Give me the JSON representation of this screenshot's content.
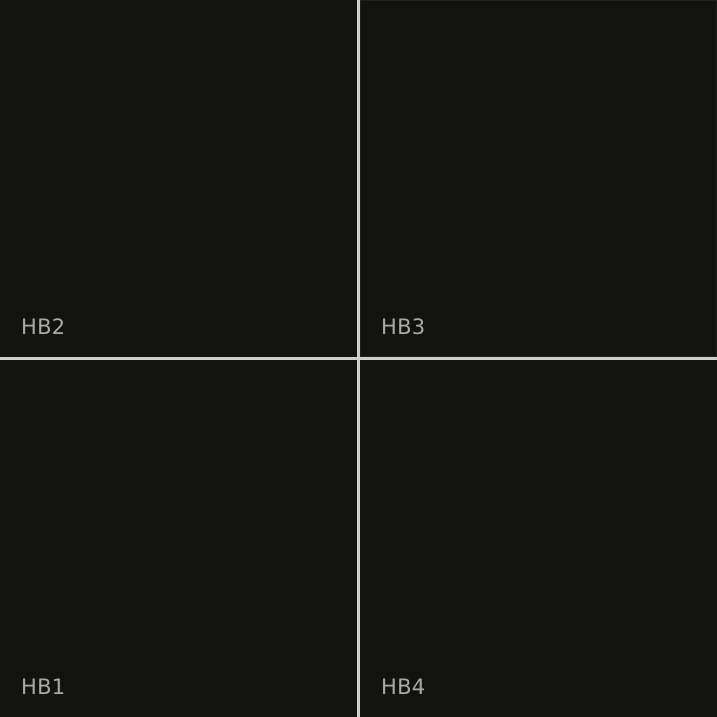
{
  "tiles": [
    {
      "label": "HB2"
    },
    {
      "label": "HB3"
    },
    {
      "label": "HB1"
    },
    {
      "label": "HB4"
    }
  ]
}
